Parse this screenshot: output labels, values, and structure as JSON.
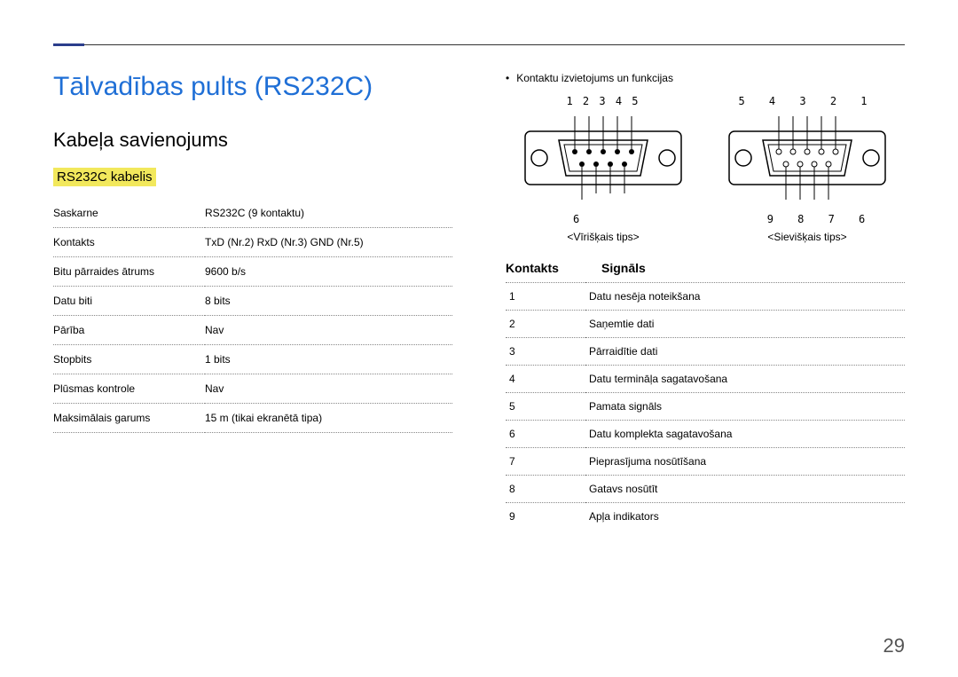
{
  "page_number": "29",
  "page_title": "Tālvadības pults (RS232C)",
  "section_title": "Kabeļa savienojums",
  "sub_title": "RS232C kabelis",
  "spec_table": [
    {
      "label": "Saskarne",
      "value": "RS232C (9 kontaktu)"
    },
    {
      "label": "Kontakts",
      "value": "TxD (Nr.2) RxD (Nr.3) GND (Nr.5)"
    },
    {
      "label": "Bitu pārraides ātrums",
      "value": "9600 b/s"
    },
    {
      "label": "Datu biti",
      "value": "8 bits"
    },
    {
      "label": "Pārība",
      "value": "Nav"
    },
    {
      "label": "Stopbits",
      "value": "1 bits"
    },
    {
      "label": "Plūsmas kontrole",
      "value": "Nav"
    },
    {
      "label": "Maksimālais garums",
      "value": "15 m (tikai ekranētā tipa)"
    }
  ],
  "right_heading": "Kontaktu izvietojums un funkcijas",
  "connectors": {
    "male": {
      "top_nums": "1 2 3 4 5",
      "bottom_num": "6",
      "caption": "<Vīrišķais tips>"
    },
    "female": {
      "top_nums": "5 4 3 2 1",
      "bottom_nums": "9 8 7 6",
      "caption": "<Sievišķais tips>"
    }
  },
  "pin_header": {
    "col1": "Kontakts",
    "col2": "Signāls"
  },
  "pin_table": [
    {
      "pin": "1",
      "signal": "Datu nesēja noteikšana"
    },
    {
      "pin": "2",
      "signal": "Saņemtie dati"
    },
    {
      "pin": "3",
      "signal": "Pārraidītie dati"
    },
    {
      "pin": "4",
      "signal": "Datu termināļa sagatavošana"
    },
    {
      "pin": "5",
      "signal": "Pamata signāls"
    },
    {
      "pin": "6",
      "signal": "Datu komplekta sagatavošana"
    },
    {
      "pin": "7",
      "signal": "Pieprasījuma nosūtīšana"
    },
    {
      "pin": "8",
      "signal": "Gatavs nosūtīt"
    },
    {
      "pin": "9",
      "signal": "Apļa indikators"
    }
  ]
}
